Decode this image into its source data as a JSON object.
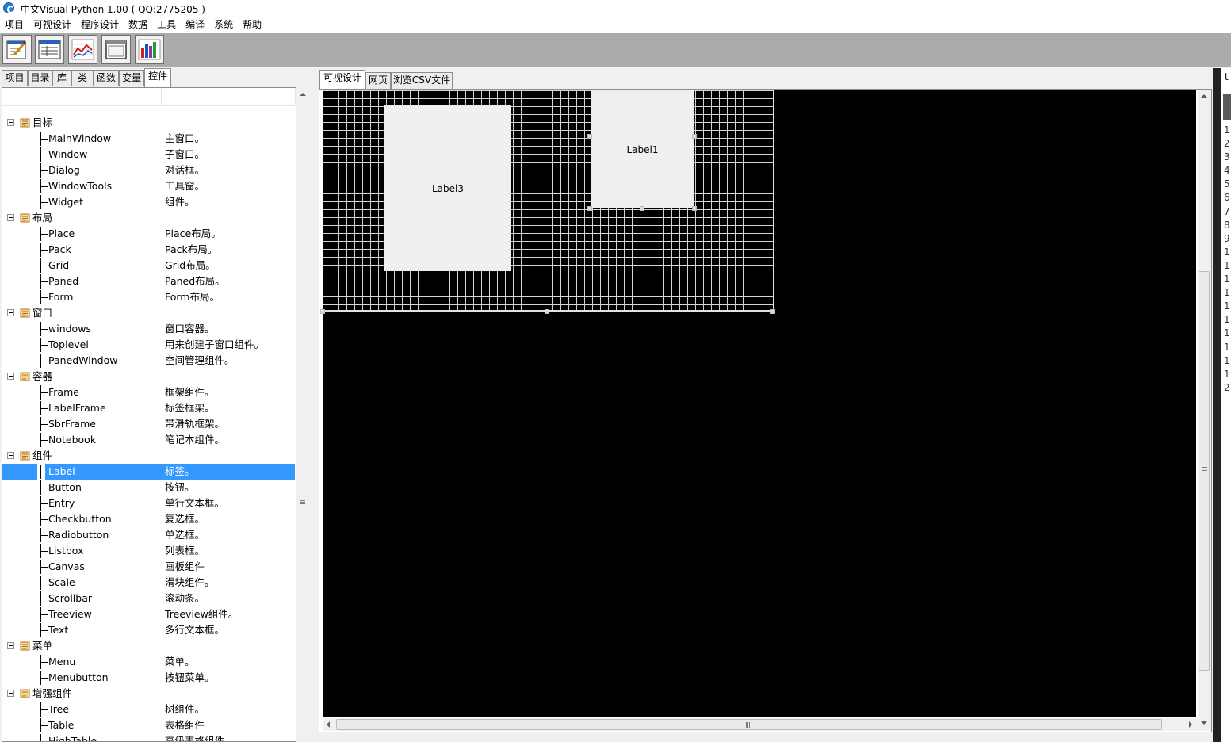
{
  "window": {
    "title": "中文Visual Python 1.00 ( QQ:2775205 )"
  },
  "menu": [
    "项目",
    "可视设计",
    "程序设计",
    "数据",
    "工具",
    "编译",
    "系统",
    "帮助"
  ],
  "toolbar": {
    "buttons": [
      {
        "icon": "edit-document-icon"
      },
      {
        "icon": "form-window-icon"
      },
      {
        "icon": "line-chart-icon"
      },
      {
        "icon": "frame-window-icon"
      },
      {
        "icon": "bar-chart-icon"
      }
    ]
  },
  "left_tabs": [
    "项目",
    "目录",
    "库",
    "类",
    "函数",
    "变量",
    "控件"
  ],
  "left_active_tab": "控件",
  "tree": [
    {
      "category": "目标",
      "items": [
        {
          "name": "MainWindow",
          "desc": "主窗口。"
        },
        {
          "name": "Window",
          "desc": "子窗口。"
        },
        {
          "name": "Dialog",
          "desc": "对话框。"
        },
        {
          "name": "WindowTools",
          "desc": "工具窗。"
        },
        {
          "name": "Widget",
          "desc": "组件。"
        }
      ]
    },
    {
      "category": "布局",
      "items": [
        {
          "name": "Place",
          "desc": "Place布局。"
        },
        {
          "name": "Pack",
          "desc": "Pack布局。"
        },
        {
          "name": "Grid",
          "desc": "Grid布局。"
        },
        {
          "name": "Paned",
          "desc": "Paned布局。"
        },
        {
          "name": "Form",
          "desc": "Form布局。"
        }
      ]
    },
    {
      "category": "窗口",
      "items": [
        {
          "name": "windows",
          "desc": "窗口容器。"
        },
        {
          "name": "Toplevel",
          "desc": "用来创建子窗口组件。"
        },
        {
          "name": "PanedWindow",
          "desc": "空间管理组件。"
        }
      ]
    },
    {
      "category": "容器",
      "items": [
        {
          "name": "Frame",
          "desc": "框架组件。"
        },
        {
          "name": "LabelFrame",
          "desc": "标签框架。"
        },
        {
          "name": "SbrFrame",
          "desc": "带滑轨框架。"
        },
        {
          "name": "Notebook",
          "desc": "笔记本组件。"
        }
      ]
    },
    {
      "category": "组件",
      "items": [
        {
          "name": "Label",
          "desc": "标签。",
          "selected": true
        },
        {
          "name": "Button",
          "desc": "按钮。"
        },
        {
          "name": "Entry",
          "desc": "单行文本框。"
        },
        {
          "name": "Checkbutton",
          "desc": "复选框。"
        },
        {
          "name": "Radiobutton",
          "desc": "单选框。"
        },
        {
          "name": "Listbox",
          "desc": "列表框。"
        },
        {
          "name": "Canvas",
          "desc": "画板组件"
        },
        {
          "name": "Scale",
          "desc": "滑块组件。"
        },
        {
          "name": "Scrollbar",
          "desc": "滚动条。"
        },
        {
          "name": "Treeview",
          "desc": "Treeview组件。"
        },
        {
          "name": "Text",
          "desc": "多行文本框。"
        }
      ]
    },
    {
      "category": "菜单",
      "items": [
        {
          "name": "Menu",
          "desc": "菜单。"
        },
        {
          "name": "Menubutton",
          "desc": "按钮菜单。"
        }
      ]
    },
    {
      "category": "增强组件",
      "items": [
        {
          "name": "Tree",
          "desc": "树组件。"
        },
        {
          "name": "Table",
          "desc": "表格组件"
        },
        {
          "name": "HighTable",
          "desc": "高级表格组件"
        }
      ]
    }
  ],
  "center_tabs": [
    "可视设计",
    "网页",
    "浏览CSV文件"
  ],
  "center_active_tab": "可视设计",
  "design": {
    "labels": [
      {
        "text": "Label3"
      },
      {
        "text": "Label1",
        "selected": true
      }
    ]
  },
  "right_panel": {
    "tab_fragment": "t",
    "line_numbers": [
      "1",
      "2",
      "3",
      "4",
      "5",
      "6",
      "7",
      "8",
      "9",
      "1",
      "1",
      "1",
      "1",
      "1",
      "1",
      "1",
      "1",
      "1",
      "1",
      "2"
    ]
  },
  "colors": {
    "selection": "#3399ff",
    "canvas": "#000000",
    "grid": "#d6d6d6"
  }
}
